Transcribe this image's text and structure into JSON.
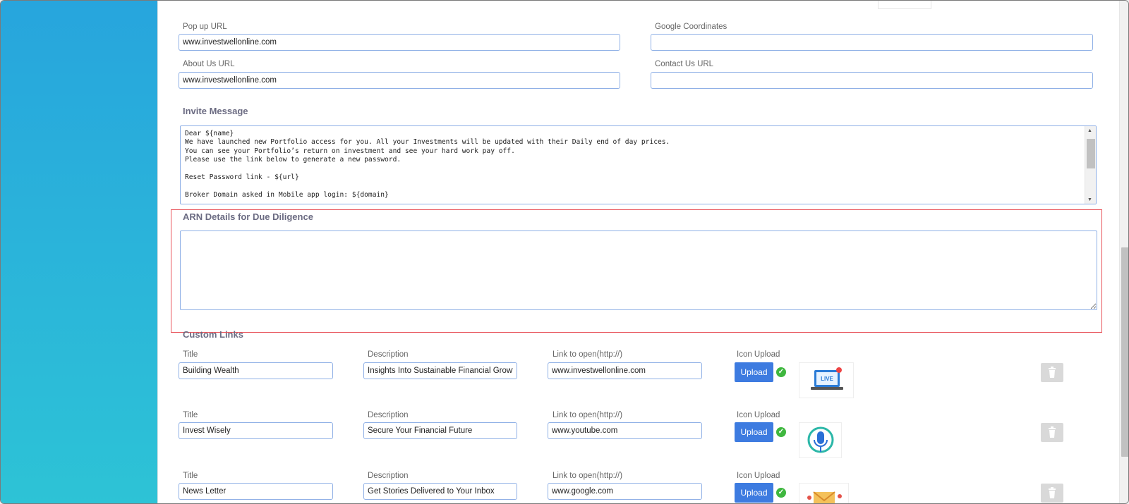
{
  "fields": {
    "popup_url": {
      "label": "Pop up URL",
      "value": "www.investwellonline.com"
    },
    "google_coordinates": {
      "label": "Google Coordinates",
      "value": ""
    },
    "about_us_url": {
      "label": "About Us URL",
      "value": "www.investwellonline.com"
    },
    "contact_us_url": {
      "label": "Contact Us URL",
      "value": ""
    }
  },
  "invite_message": {
    "heading": "Invite Message",
    "text": "Dear ${name}\nWe have launched new Portfolio access for you. All your Investments will be updated with their Daily end of day prices.\nYou can see your Portfolio’s return on investment and see your hard work pay off.\nPlease use the link below to generate a new password.\n\nReset Password link - ${url}\n\nBroker Domain asked in Mobile app login: ${domain}"
  },
  "arn_details": {
    "heading": "ARN Details for Due Diligence",
    "value": ""
  },
  "custom_links": {
    "heading": "Custom Links",
    "labels": {
      "title": "Title",
      "description": "Description",
      "link": "Link to open(http://)",
      "icon": "Icon Upload",
      "upload_button": "Upload"
    },
    "rows": [
      {
        "title": "Building Wealth",
        "description": "Insights Into Sustainable Financial Growth",
        "link": "www.investwellonline.com",
        "icon": "live-webinar-laptop-icon",
        "thumb_text": "LIVE"
      },
      {
        "title": "Invest Wisely",
        "description": "Secure Your Financial Future",
        "link": "www.youtube.com",
        "icon": "podcast-microphone-icon"
      },
      {
        "title": "News Letter",
        "description": "Get Stories Delivered to Your Inbox",
        "link": "www.google.com",
        "icon": "newsletter-envelope-icon"
      }
    ]
  },
  "colors": {
    "accent": "#3d7be0",
    "sidebar": "#2bb7d9",
    "success": "#3fb73f",
    "highlight": "#e8535a"
  }
}
